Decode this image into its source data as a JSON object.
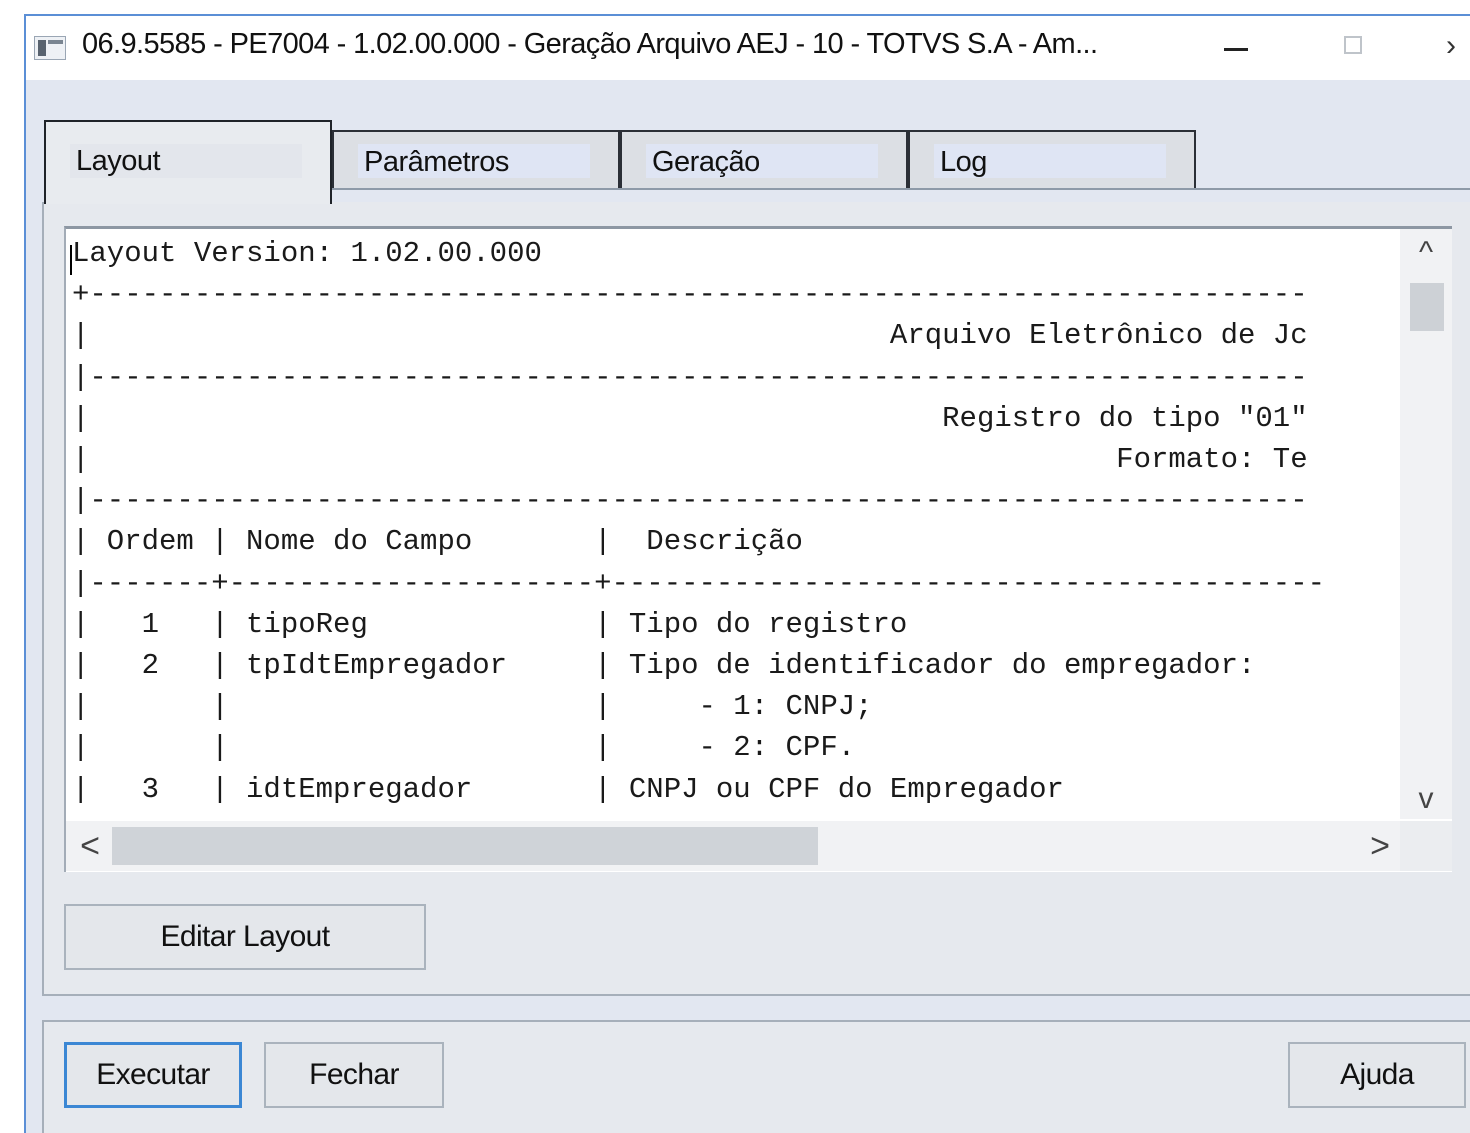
{
  "window": {
    "title": "06.9.5585 - PE7004 - 1.02.00.000 - Geração Arquivo AEJ - 10 - TOTVS S.A - Am...",
    "close_glyph": "›"
  },
  "tabs": [
    {
      "label": "Layout",
      "active": true
    },
    {
      "label": "Parâmetros",
      "active": false
    },
    {
      "label": "Geração",
      "active": false
    },
    {
      "label": "Log",
      "active": false
    }
  ],
  "layout_panel": {
    "lines": [
      "Layout Version: 1.02.00.000",
      "+----------------------------------------------------------------------",
      "|                                              Arquivo Eletrônico de Jc",
      "|----------------------------------------------------------------------",
      "|                                                 Registro do tipo \"01\"",
      "|                                                           Formato: Te",
      "|----------------------------------------------------------------------",
      "| Ordem | Nome do Campo       |  Descrição",
      "|-------+---------------------+-----------------------------------------",
      "|   1   | tipoReg             | Tipo do registro",
      "|   2   | tpIdtEmpregador     | Tipo de identificador do empregador:",
      "|       |                     |     - 1: CNPJ;",
      "|       |                     |     - 2: CPF.",
      "|   3   | idtEmpregador       | CNPJ ou CPF do Empregador"
    ],
    "scroll_up_glyph": "^",
    "scroll_down_glyph": "v",
    "scroll_left_glyph": "<",
    "scroll_right_glyph": ">"
  },
  "buttons": {
    "edit_layout": "Editar Layout",
    "execute": "Executar",
    "close": "Fechar",
    "help": "Ajuda"
  }
}
